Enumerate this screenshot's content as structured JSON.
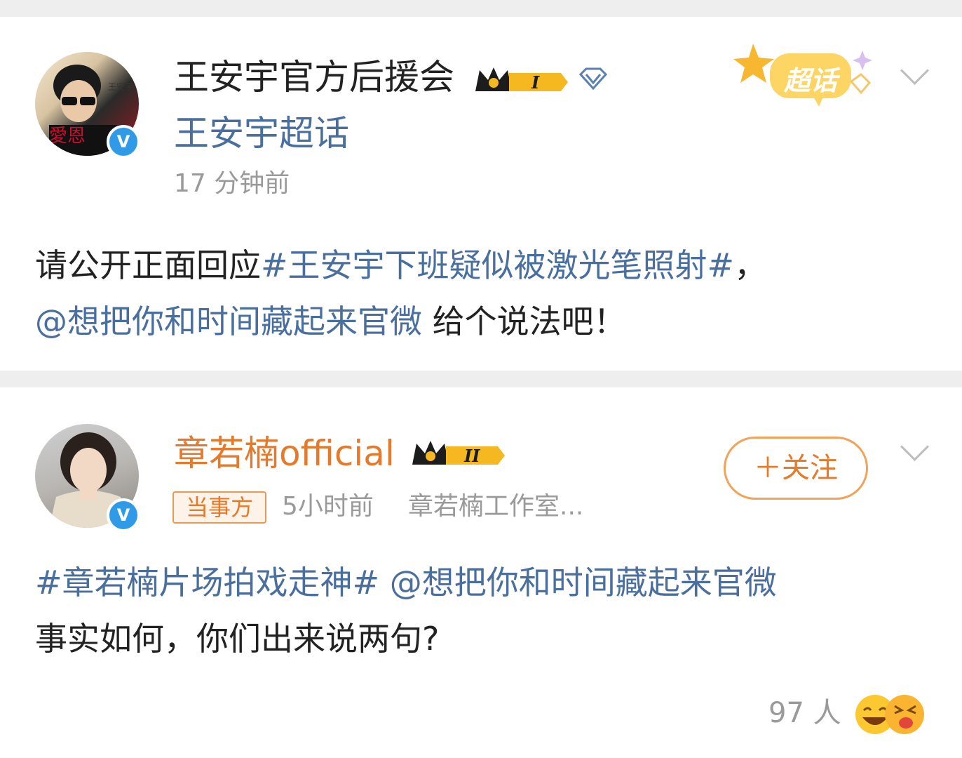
{
  "post1": {
    "author": "王安宇官方后援会",
    "level": "I",
    "source": "王安宇超话",
    "time": "17 分钟前",
    "supertopic_badge": "超话",
    "line1": {
      "prefix": "请公开正面回应",
      "hashtag": "#王安宇下班疑似被激光笔照射#",
      "suffix": "，"
    },
    "line2": {
      "mention": "@想把你和时间藏起来官微",
      "suffix": " 给个说法吧！"
    }
  },
  "post2": {
    "author": "章若楠official",
    "level": "II",
    "follow_label": "＋关注",
    "party_tag": "当事方",
    "time": "5小时前",
    "source": "章若楠工作室...",
    "line1": {
      "hashtag": "#章若楠片场拍戏走神#",
      "mention": " @想把你和时间藏起来官微"
    },
    "line2": "事实如何，你们出来说两句?",
    "reactions_count": "97 人"
  },
  "colors": {
    "link_blue": "#4a6f9e",
    "brand_orange": "#e67a2b",
    "verified_blue": "#2f9be8",
    "crown_gold": "#f5b820",
    "background": "#eeeeee"
  }
}
